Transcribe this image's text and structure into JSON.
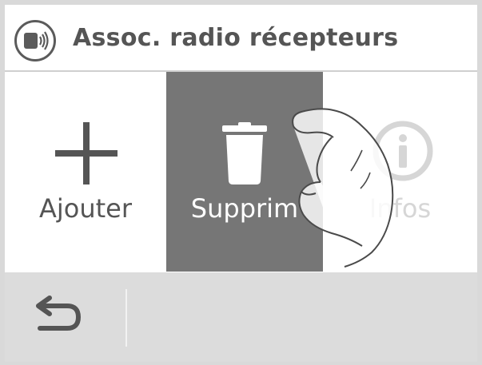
{
  "header": {
    "title": "Assoc. radio récepteurs",
    "icon": "radio-signal-icon"
  },
  "tiles": [
    {
      "label": "Ajouter",
      "icon": "plus-icon",
      "state": "normal"
    },
    {
      "label": "Supprim",
      "icon": "trash-icon",
      "state": "pressed"
    },
    {
      "label": "Infos",
      "icon": "info-icon",
      "state": "normal"
    }
  ],
  "footer": {
    "back_icon": "back-arrow-icon"
  },
  "colors": {
    "text": "#555555",
    "pressed_bg": "#767676",
    "footer_bg": "#dcdcdc",
    "frame": "#d9d9d9"
  }
}
